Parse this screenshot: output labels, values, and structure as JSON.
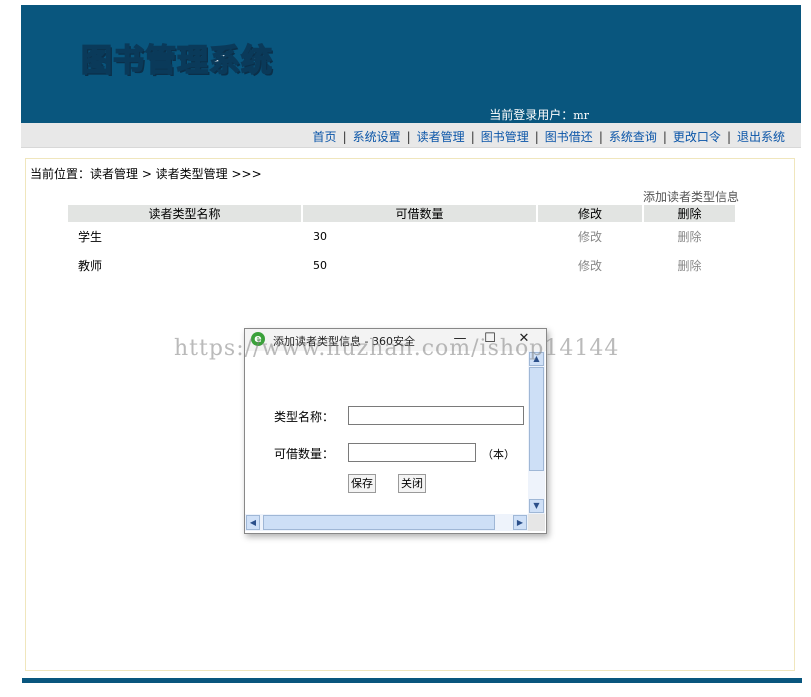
{
  "header": {
    "logo": "图书管理系统",
    "user_label": "当前登录用户：",
    "user_name": "mr"
  },
  "nav": {
    "items": [
      "首页",
      "系统设置",
      "读者管理",
      "图书管理",
      "图书借还",
      "系统查询",
      "更改口令",
      "退出系统"
    ],
    "separator": "|"
  },
  "main": {
    "breadcrumb": "当前位置：读者管理 > 读者类型管理 >>>",
    "add_link": "添加读者类型信息",
    "table": {
      "headers": [
        "读者类型名称",
        "可借数量",
        "修改",
        "删除"
      ],
      "rows": [
        {
          "name": "学生",
          "count": "30",
          "edit": "修改",
          "delete": "删除"
        },
        {
          "name": "教师",
          "count": "50",
          "edit": "修改",
          "delete": "删除"
        }
      ]
    }
  },
  "watermark": "https://www.huzhan.com/ishop14144",
  "popup": {
    "title": "添加读者类型信息 - 360安全",
    "icon": "browser-e-icon",
    "name_label": "类型名称：",
    "name_value": "",
    "count_label": "可借数量：",
    "count_value": "",
    "count_unit": "（本）",
    "save": "保存",
    "close": "关闭",
    "window_buttons": {
      "minimize": "—",
      "maximize": "☐",
      "close": "✕"
    }
  }
}
